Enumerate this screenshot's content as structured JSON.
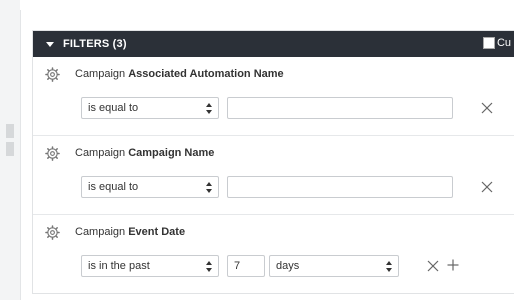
{
  "header": {
    "title": "FILTERS (3)",
    "checkbox_label": "Cu"
  },
  "filters": [
    {
      "prefix": "Campaign",
      "field": "Associated Automation Name",
      "operator": "is equal to",
      "value": ""
    },
    {
      "prefix": "Campaign",
      "field": "Campaign Name",
      "operator": "is equal to",
      "value": ""
    },
    {
      "prefix": "Campaign",
      "field": "Event Date",
      "operator": "is in the past",
      "value": "7",
      "unit": "days"
    }
  ],
  "icons": {
    "settings": "gear-icon",
    "remove": "close-icon",
    "add": "plus-icon",
    "collapse": "caret-down-icon"
  },
  "colors": {
    "header_bg": "#2b3038",
    "header_text": "#ffffff",
    "border": "#c9ccd0"
  }
}
